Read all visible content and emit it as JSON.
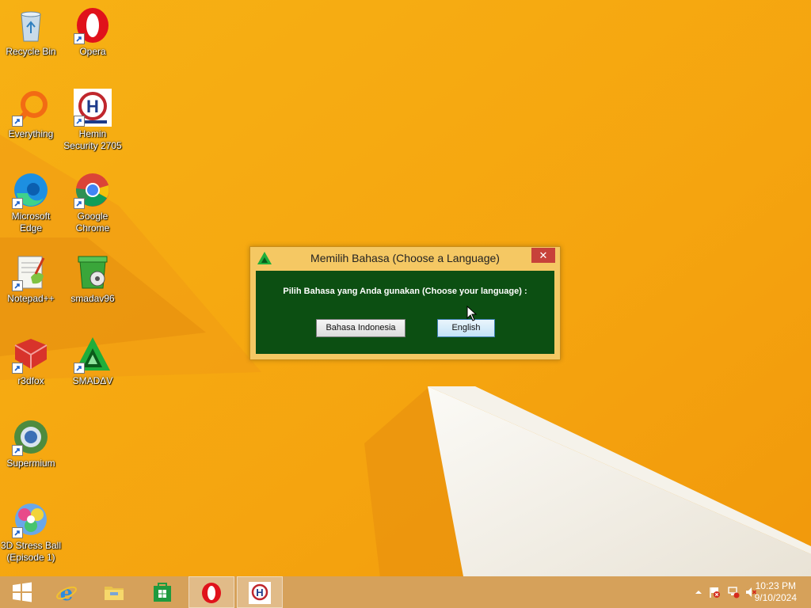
{
  "desktop": {
    "icons": [
      {
        "label": "Recycle Bin",
        "icon": "recycle-bin-icon"
      },
      {
        "label": "Opera",
        "icon": "opera-icon"
      },
      {
        "label": "Everything",
        "icon": "everything-search-icon"
      },
      {
        "label": "Hemin\nSecurity 2705",
        "icon": "hemin-security-icon"
      },
      {
        "label": "Microsoft\nEdge",
        "icon": "edge-icon"
      },
      {
        "label": "Google\nChrome",
        "icon": "chrome-icon"
      },
      {
        "label": "Notepad++",
        "icon": "notepadpp-icon"
      },
      {
        "label": "smadav96",
        "icon": "smadav-installer-icon"
      },
      {
        "label": "r3dfox",
        "icon": "r3dfox-icon"
      },
      {
        "label": "SMADΔV",
        "icon": "smadav-icon"
      },
      {
        "label": "Supermium",
        "icon": "supermium-icon"
      },
      {
        "label": "3D Stress Ball\n(Episode 1)",
        "icon": "stress-ball-icon"
      }
    ]
  },
  "dialog": {
    "title": "Memilih Bahasa (Choose a Language)",
    "close_label": "✕",
    "prompt": "Pilih Bahasa yang Anda gunakan (Choose your language) :",
    "buttons": {
      "indonesian": "Bahasa Indonesia",
      "english": "English"
    }
  },
  "taskbar": {
    "items": [
      "start-icon",
      "internet-explorer-icon",
      "file-explorer-icon",
      "store-icon",
      "opera-icon",
      "hemin-security-icon"
    ],
    "tray": {
      "icons": [
        "show-hidden-icons-icon",
        "action-center-flag-icon",
        "network-icon",
        "volume-muted-icon"
      ],
      "time": "10:23 PM",
      "date": "9/10/2024"
    }
  },
  "colors": {
    "wallpaper": "#f4a613",
    "dialog_frame": "#f5c863",
    "dialog_client": "#0c4f12",
    "close_button": "#c7423a",
    "taskbar": "#d6a15a"
  }
}
